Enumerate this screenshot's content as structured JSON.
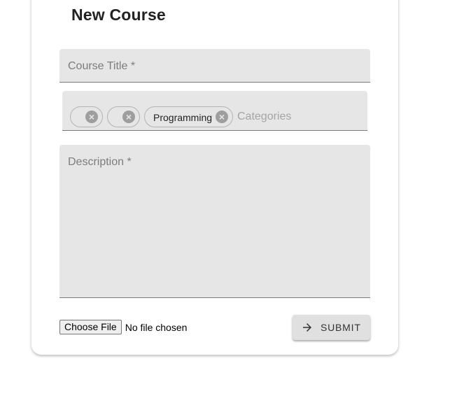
{
  "form": {
    "title": "New Course",
    "course_title": {
      "label": "Course Title *",
      "value": ""
    },
    "categories": {
      "placeholder": "Categories",
      "chips": [
        {
          "label": ""
        },
        {
          "label": ""
        },
        {
          "label": "Programming"
        }
      ]
    },
    "description": {
      "label": "Description *",
      "value": ""
    },
    "file_upload": {
      "button_label": "Choose File",
      "status": "No file chosen"
    },
    "submit": {
      "label": "SUBMIT",
      "icon": "arrow-right-icon"
    }
  },
  "colors": {
    "field_background": "#e6e6e6",
    "field_underline": "#7a7a7a",
    "label_text": "#7c7c7c",
    "button_background": "#e0e0e0"
  }
}
